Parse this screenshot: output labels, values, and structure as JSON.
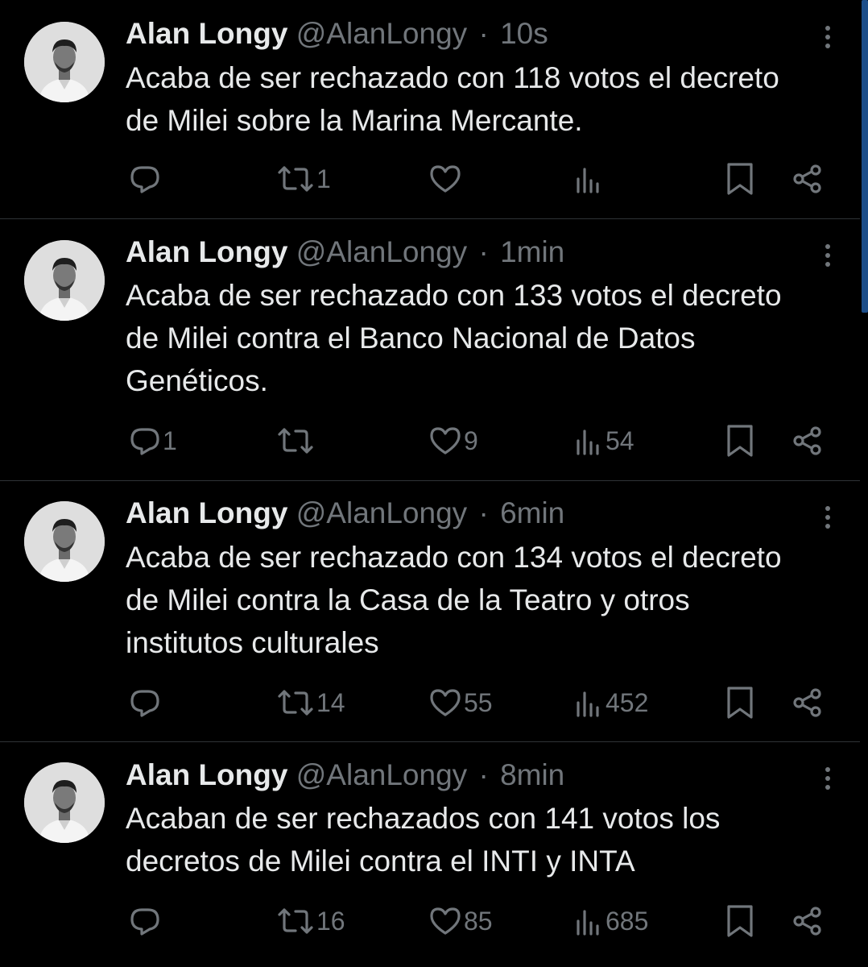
{
  "tweets": [
    {
      "name": "Alan Longy",
      "handle": "@AlanLongy",
      "separator": "·",
      "time": "10s",
      "text_lines": [
        "Acaba de ser rechazado con 118 votos el decreto",
        "de Milei sobre la Marina Mercante."
      ],
      "replies": "",
      "retweets": "1",
      "likes": "",
      "views": ""
    },
    {
      "name": "Alan Longy",
      "handle": "@AlanLongy",
      "separator": "·",
      "time": "1min",
      "text_lines": [
        "Acaba de ser rechazado con 133 votos el decreto",
        "de Milei contra el Banco Nacional de Datos",
        "Genéticos."
      ],
      "replies": "1",
      "retweets": "",
      "likes": "9",
      "views": "54"
    },
    {
      "name": "Alan Longy",
      "handle": "@AlanLongy",
      "separator": "·",
      "time": "6min",
      "text_lines": [
        "Acaba de ser rechazado con 134 votos el decreto",
        "de Milei contra la Casa de la Teatro y otros",
        "institutos culturales"
      ],
      "replies": "",
      "retweets": "14",
      "likes": "55",
      "views": "452"
    },
    {
      "name": "Alan Longy",
      "handle": "@AlanLongy",
      "separator": "·",
      "time": "8min",
      "text_lines": [
        "Acaban de ser rechazados con 141 votos los",
        "decretos de Milei contra el INTI y INTA"
      ],
      "replies": "",
      "retweets": "16",
      "likes": "85",
      "views": "685"
    }
  ],
  "icons": {
    "reply": "reply-icon",
    "retweet": "retweet-icon",
    "like": "heart-icon",
    "views": "views-icon",
    "bookmark": "bookmark-icon",
    "share": "share-icon",
    "more": "more-options-icon"
  },
  "colors": {
    "background": "#000000",
    "text": "#e7e9ea",
    "muted": "#71767b",
    "divider": "#2f3336",
    "scrollbar": "#1d4e89"
  }
}
